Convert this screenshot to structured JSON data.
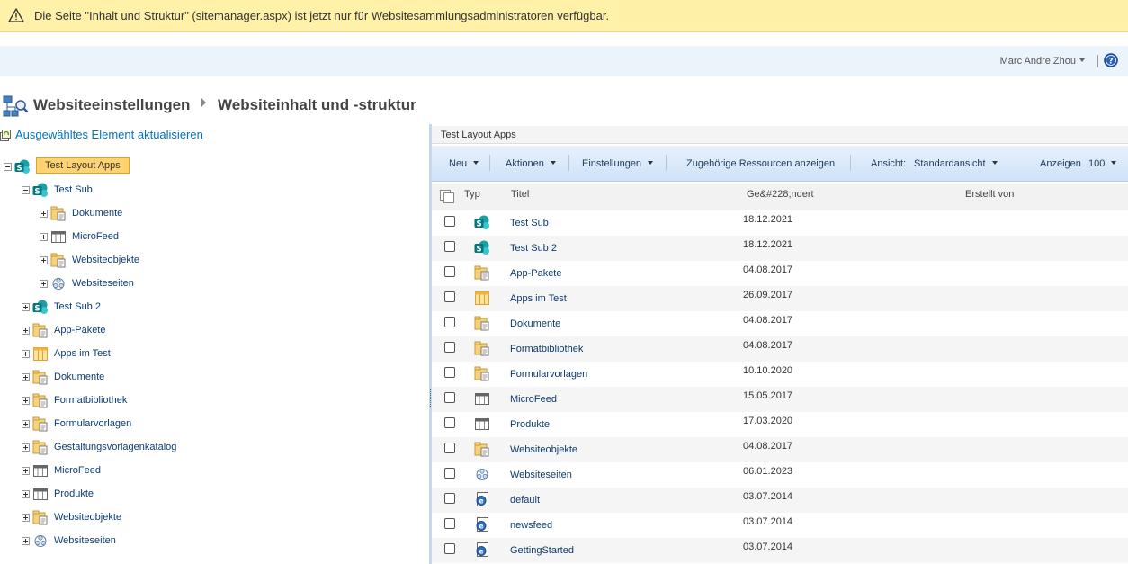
{
  "notice": {
    "text": "Die Seite \"Inhalt und Struktur\" (sitemanager.aspx) ist jetzt nur für Websitesammlungsadministratoren verfügbar."
  },
  "suite": {
    "user_name": "Marc Andre Zhou",
    "help_icon": "help-icon"
  },
  "breadcrumb": {
    "part1": "Websiteeinstellungen",
    "part2": "Websiteinhalt und -struktur"
  },
  "tree": {
    "refresh_label": "Ausgewähltes Element aktualisieren",
    "items": [
      {
        "label": "Test Layout Apps",
        "icon": "sharepoint-site-icon",
        "level": 0,
        "expander": "minus",
        "selected": true
      },
      {
        "label": "Test Sub",
        "icon": "sharepoint-site-icon",
        "level": 1,
        "expander": "minus"
      },
      {
        "label": "Dokumente",
        "icon": "document-library-icon",
        "level": 2,
        "expander": "plus"
      },
      {
        "label": "MicroFeed",
        "icon": "list-icon",
        "level": 2,
        "expander": "plus"
      },
      {
        "label": "Websiteobjekte",
        "icon": "document-library-icon",
        "level": 2,
        "expander": "plus"
      },
      {
        "label": "Websiteseiten",
        "icon": "wiki-pages-icon",
        "level": 2,
        "expander": "plus"
      },
      {
        "label": "Test Sub 2",
        "icon": "sharepoint-site-icon",
        "level": 1,
        "expander": "plus"
      },
      {
        "label": "App-Pakete",
        "icon": "document-library-icon",
        "level": 1,
        "expander": "plus"
      },
      {
        "label": "Apps im Test",
        "icon": "apps-list-icon",
        "level": 1,
        "expander": "plus"
      },
      {
        "label": "Dokumente",
        "icon": "document-library-icon",
        "level": 1,
        "expander": "plus"
      },
      {
        "label": "Formatbibliothek",
        "icon": "document-library-icon",
        "level": 1,
        "expander": "plus"
      },
      {
        "label": "Formularvorlagen",
        "icon": "document-library-icon",
        "level": 1,
        "expander": "plus"
      },
      {
        "label": "Gestaltungsvorlagenkatalog",
        "icon": "document-library-icon",
        "level": 1,
        "expander": "plus"
      },
      {
        "label": "MicroFeed",
        "icon": "list-icon",
        "level": 1,
        "expander": "plus"
      },
      {
        "label": "Produkte",
        "icon": "list-icon",
        "level": 1,
        "expander": "plus"
      },
      {
        "label": "Websiteobjekte",
        "icon": "document-library-icon",
        "level": 1,
        "expander": "plus"
      },
      {
        "label": "Websiteseiten",
        "icon": "wiki-pages-icon",
        "level": 1,
        "expander": "plus"
      }
    ]
  },
  "content": {
    "header_title": "Test Layout Apps",
    "toolbar": {
      "new_label": "Neu",
      "actions_label": "Aktionen",
      "settings_label": "Einstellungen",
      "related_label": "Zugehörige Ressourcen anzeigen",
      "view_label": "Ansicht:",
      "view_value": "Standardansicht",
      "show_label": "Anzeigen",
      "show_value": "100"
    },
    "columns": {
      "type": "Typ",
      "title": "Titel",
      "modified": "Ge&#228;ndert",
      "created_by": "Erstellt von"
    },
    "rows": [
      {
        "title": "Test Sub",
        "modified": "18.12.2021",
        "icon": "sharepoint-site-icon"
      },
      {
        "title": "Test Sub 2",
        "modified": "18.12.2021",
        "icon": "sharepoint-site-icon"
      },
      {
        "title": "App-Pakete",
        "modified": "04.08.2017",
        "icon": "document-library-icon"
      },
      {
        "title": "Apps im Test",
        "modified": "26.09.2017",
        "icon": "apps-list-icon"
      },
      {
        "title": "Dokumente",
        "modified": "04.08.2017",
        "icon": "document-library-icon"
      },
      {
        "title": "Formatbibliothek",
        "modified": "04.08.2017",
        "icon": "document-library-icon"
      },
      {
        "title": "Formularvorlagen",
        "modified": "10.10.2020",
        "icon": "document-library-icon"
      },
      {
        "title": "MicroFeed",
        "modified": "15.05.2017",
        "icon": "list-icon"
      },
      {
        "title": "Produkte",
        "modified": "17.03.2020",
        "icon": "list-icon"
      },
      {
        "title": "Websiteobjekte",
        "modified": "04.08.2017",
        "icon": "document-library-icon"
      },
      {
        "title": "Websiteseiten",
        "modified": "06.01.2023",
        "icon": "wiki-pages-icon"
      },
      {
        "title": "default",
        "modified": "03.07.2014",
        "icon": "web-page-icon"
      },
      {
        "title": "newsfeed",
        "modified": "03.07.2014",
        "icon": "web-page-icon"
      },
      {
        "title": "GettingStarted",
        "modified": "03.07.2014",
        "icon": "web-page-icon"
      }
    ]
  },
  "colors": {
    "notice_bg": "#fff1a8",
    "suite_bg": "#ebf3fb",
    "link": "#0d3b70",
    "selected_bg": "#ffd36f",
    "toolbar_bg": "#d6e6f9",
    "sharepoint_teal": "#03787c"
  }
}
